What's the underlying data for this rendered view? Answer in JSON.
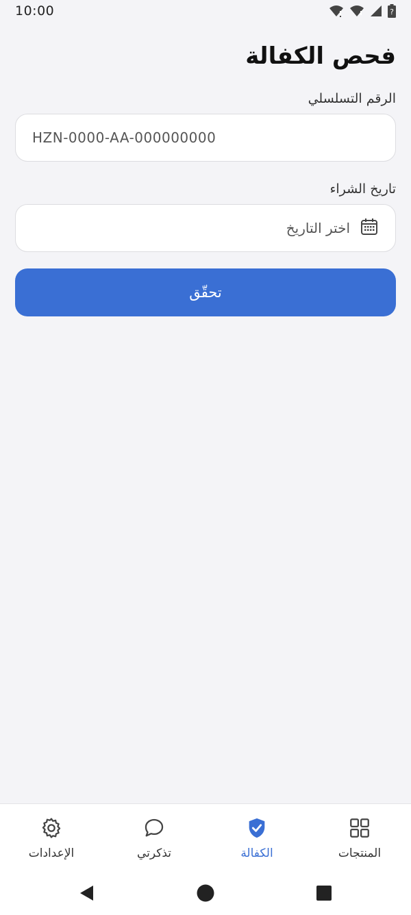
{
  "status_bar": {
    "time": "10:00",
    "icons": [
      "wifi-icon",
      "signal-icon",
      "signal-icon",
      "battery-icon"
    ]
  },
  "page": {
    "title": "فحص الكفالة"
  },
  "form": {
    "serial": {
      "label": "الرقم التسلسلي",
      "value": "HZN-0000-AA-000000000"
    },
    "purchase_date": {
      "label": "تاريخ الشراء",
      "placeholder": "اختر التاريخ",
      "icon": "calendar-icon"
    },
    "verify_button": "تحقّق"
  },
  "bottom_nav": {
    "items": [
      {
        "label": "المنتجات",
        "icon": "grid-icon",
        "active": false
      },
      {
        "label": "الكفالة",
        "icon": "shield-check-icon",
        "active": true
      },
      {
        "label": "تذكرتي",
        "icon": "chat-bubble-icon",
        "active": false
      },
      {
        "label": "الإعدادات",
        "icon": "gear-icon",
        "active": false
      }
    ]
  },
  "colors": {
    "accent": "#3a6fd4",
    "background": "#f4f4f7"
  },
  "system_nav": [
    "back-icon",
    "home-icon",
    "recents-icon"
  ]
}
